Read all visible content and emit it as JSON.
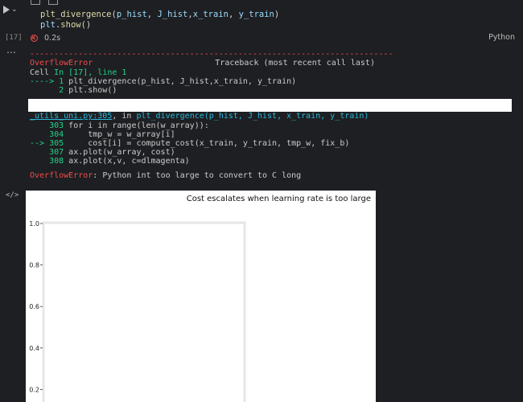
{
  "cell": {
    "code_lines": [
      {
        "parts": [
          {
            "t": "plt_divergence",
            "c": "fn"
          },
          {
            "t": "(",
            "c": "plain"
          },
          {
            "t": "p_hist",
            "c": "var"
          },
          {
            "t": ", ",
            "c": "plain"
          },
          {
            "t": "J_hist",
            "c": "var"
          },
          {
            "t": ",",
            "c": "plain"
          },
          {
            "t": "x_train",
            "c": "var"
          },
          {
            "t": ", ",
            "c": "plain"
          },
          {
            "t": "y_train",
            "c": "var"
          },
          {
            "t": ")",
            "c": "plain"
          }
        ]
      },
      {
        "parts": [
          {
            "t": "plt",
            "c": "var"
          },
          {
            "t": ".",
            "c": "plain"
          },
          {
            "t": "show",
            "c": "fn"
          },
          {
            "t": "()",
            "c": "plain"
          }
        ]
      }
    ],
    "execution_count": "[17]",
    "duration": "0.2s",
    "language": "Python"
  },
  "output": {
    "more_icon": "ellipsis-icon",
    "separator": "---------------------------------------------------------------------------",
    "error_name": "OverflowError",
    "traceback_label": "Traceback (most recent call last)",
    "cell_ref_prefix": "Cell ",
    "cell_ref": "In [17], line 1",
    "arrow_line_prefix": "----> 1 ",
    "arrow_line_code": "plt_divergence(p_hist, J_hist,x_train, y_train)",
    "line2_prefix": "      2 ",
    "line2_code": "plt.show()",
    "file_ref": "_utils_uni.py:305",
    "file_ref_in": ", in ",
    "func_ref": "plt_divergence(p_hist, J_hist, x_train, y_train)",
    "src_lines": [
      {
        "prefix": "    303 ",
        "code": "for i in range(len(w_array)):",
        "arrow": false
      },
      {
        "prefix": "    304 ",
        "code": "    tmp_w = w_array[i]",
        "arrow": false
      },
      {
        "prefix": "--> 305 ",
        "code": "    cost[i] = compute_cost(x_train, y_train, tmp_w, fix_b)",
        "arrow": true
      },
      {
        "prefix": "    307 ",
        "code": "ax.plot(w_array, cost)",
        "arrow": false
      },
      {
        "prefix": "    308 ",
        "code": "ax.plot(x,v, c=dlmagenta)",
        "arrow": false
      }
    ],
    "final_error_name": "OverflowError",
    "final_error_msg": ": Python int too large to convert to C long"
  },
  "plot_output": {
    "icon": "code-output-icon",
    "title": "Cost escalates when learning rate is too large"
  },
  "chart_data": {
    "type": "line",
    "title": "Cost escalates when learning rate is too large",
    "xlabel": "",
    "ylabel": "",
    "ylim": [
      0,
      1.0
    ],
    "y_ticks": [
      "1.0",
      "0.8",
      "0.6",
      "0.4",
      "0.2"
    ],
    "series": [],
    "grid": false
  }
}
